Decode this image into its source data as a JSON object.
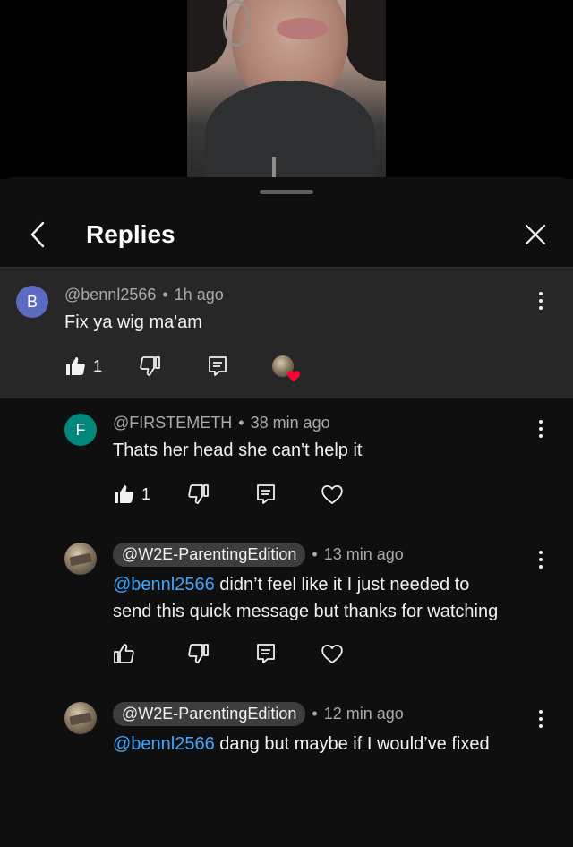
{
  "header": {
    "title": "Replies"
  },
  "comments": [
    {
      "avatar_letter": "B",
      "author": "@bennl2566",
      "time": "1h ago",
      "mention": "",
      "text": "Fix ya wig ma'am",
      "likes": "1"
    },
    {
      "avatar_letter": "F",
      "author": "@FIRSTEMETH",
      "time": "38 min ago",
      "mention": "",
      "text": "Thats her head she can't help it",
      "likes": "1"
    },
    {
      "avatar_letter": "",
      "author": "@W2E-ParentingEdition",
      "time": "13 min ago",
      "mention": "@bennl2566",
      "text_line1": " didn’t feel like it I just needed to",
      "text_line2": "send this quick message but thanks for watching",
      "likes": ""
    },
    {
      "avatar_letter": "",
      "author": "@W2E-ParentingEdition",
      "time": "12 min ago",
      "mention": "@bennl2566",
      "text_line1": " dang but maybe if I would’ve fixed",
      "likes": ""
    }
  ],
  "separator": "•",
  "colors": {
    "background": "#0f0f0f",
    "highlight": "#272727",
    "mention": "#3ea6ff",
    "heart": "#ff0033"
  }
}
